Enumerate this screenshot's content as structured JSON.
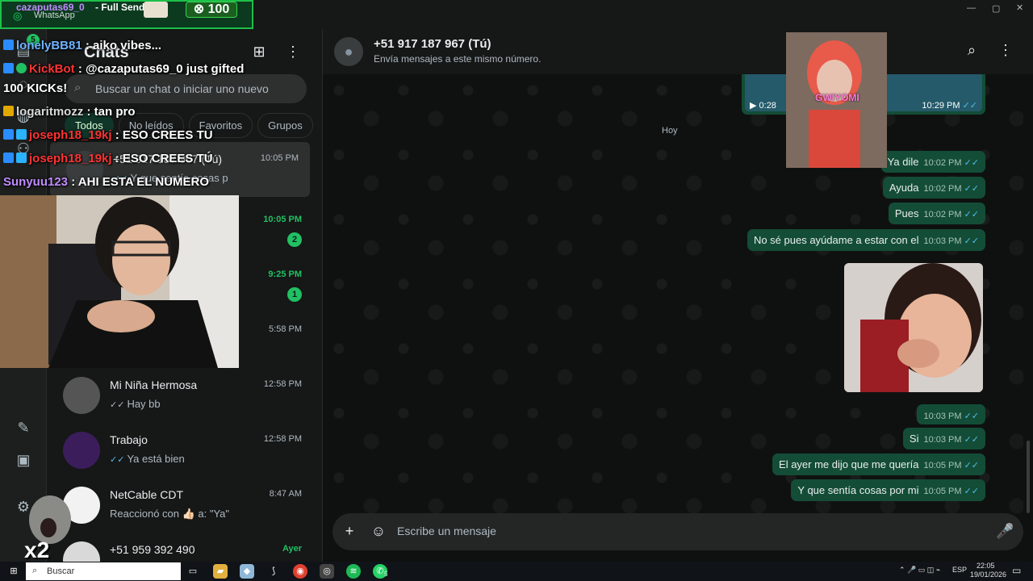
{
  "window": {
    "title": "WhatsApp"
  },
  "overlay_top": {
    "username": "cazaputas69_0",
    "action": "- Full Send",
    "app_label": "WhatsApp",
    "kicks": "100",
    "kick_badge_count": "5"
  },
  "stream_chat": [
    {
      "user": "lonelyBB81",
      "user_color": "#6fb3ff",
      "text": " : aiko vibes..."
    },
    {
      "user": "KickBot",
      "user_color": "#ff3333",
      "text": " : @cazaputas69_0 just gifted",
      "text2": "100 KICKs!"
    },
    {
      "user": "logaritmozz",
      "user_color": "#d9d9d9",
      "text": " : tan pro"
    },
    {
      "user": "joseph18_19kj",
      "user_color": "#ff3333",
      "text": " : ESO CREES TU"
    },
    {
      "user": "joseph18_19kj",
      "user_color": "#ff3333",
      "text": " : ESO CREES TÚ"
    },
    {
      "user": "Sunyuu123",
      "user_color": "#c08cff",
      "text": " : AHI ESTA EL NUMERO"
    }
  ],
  "emote_label": "x2",
  "sidebar": {
    "title": "Chats",
    "search_placeholder": "Buscar un chat o iniciar uno nuevo",
    "filters": [
      "Todos",
      "No leídos",
      "Favoritos",
      "Grupos"
    ],
    "selected_chat": {
      "name": "+51 917 187 967 (Tú)",
      "time": "10:05 PM",
      "preview": "Y que sentía cosas p"
    },
    "hidden_rows": [
      {
        "time": "10:05 PM",
        "badge": "2"
      },
      {
        "time": "9:25 PM",
        "badge": "1"
      },
      {
        "time": "5:58 PM",
        "badge": ""
      }
    ],
    "chats": [
      {
        "name": "Mi Niña Hermosa",
        "preview": "Hay bb",
        "time": "12:58 PM"
      },
      {
        "name": "Trabajo",
        "preview": "Ya está bien",
        "time": "12:58 PM"
      },
      {
        "name": "NetCable CDT",
        "preview": "Reaccionó con 👍🏻 a: \"Ya\"",
        "time": "8:47 AM"
      },
      {
        "name": "+51 959 392 490",
        "preview": "",
        "time": "Ayer"
      }
    ]
  },
  "conversation": {
    "name": "+51 917 187 967 (Tú)",
    "subtitle": "Envía mensajes a este mismo número.",
    "day_pill": "Hoy",
    "video": {
      "duration": "0:28",
      "time": "10:29 PM"
    },
    "messages": [
      {
        "text": "Ya dile",
        "time": "10:02 PM"
      },
      {
        "text": "Ayuda",
        "time": "10:02 PM"
      },
      {
        "text": "Pues",
        "time": "10:02 PM"
      },
      {
        "text": "No sé pues ayúdame a estar con el",
        "time": "10:03 PM"
      },
      {
        "text": "",
        "time": "10:03 PM"
      },
      {
        "text": "Si",
        "time": "10:03 PM"
      },
      {
        "text": "El ayer me dijo que me quería",
        "time": "10:05 PM"
      },
      {
        "text": "Y que sentía cosas por mi",
        "time": "10:05 PM"
      }
    ],
    "composer_placeholder": "Escribe un mensaje",
    "tiktok_caption": "GWIYOMI"
  },
  "taskbar": {
    "search": "Buscar",
    "lang": "ESP",
    "time": "22:05",
    "date": "19/01/2026",
    "whatsapp_badge": "5"
  },
  "colors": {
    "bubble_out": "#144d37",
    "accent_green": "#21c063",
    "read_tick": "#53bdeb"
  }
}
